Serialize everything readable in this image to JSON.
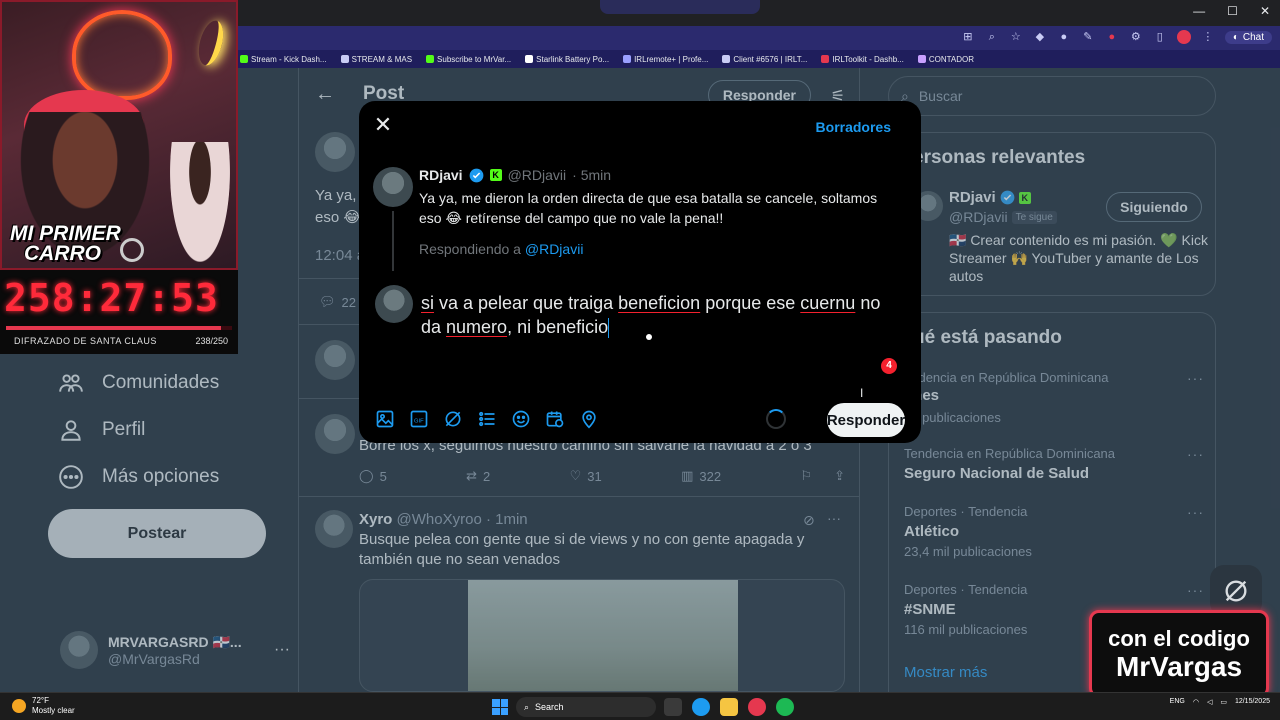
{
  "browser": {
    "controls": [
      "—",
      "☐",
      "✕"
    ],
    "chat_label": "Chat",
    "bookmarks": [
      {
        "label": "Stream - Kick Dash...",
        "color": "#53fc18"
      },
      {
        "label": "STREAM & MAS",
        "color": "#c9ccf5"
      },
      {
        "label": "Subscribe to MrVar...",
        "color": "#53fc18"
      },
      {
        "label": "Starlink Battery Po...",
        "color": "#ffffff"
      },
      {
        "label": "IRLremote+ | Profe...",
        "color": "#9aa0ff"
      },
      {
        "label": "Client #6576 | IRLT...",
        "color": "#c9ccf5"
      },
      {
        "label": "IRLToolkit - Dashb...",
        "color": "#e5384f"
      },
      {
        "label": "CONTADOR",
        "color": "#c9a0ff"
      }
    ]
  },
  "nav": {
    "items": [
      {
        "label": "Comunidades",
        "icon": "communities-icon"
      },
      {
        "label": "Perfil",
        "icon": "profile-icon"
      },
      {
        "label": "Más opciones",
        "icon": "more-options-icon"
      }
    ],
    "post_button": "Postear",
    "account": {
      "name": "MRVARGASRD 🇩🇴...",
      "handle": "@MrVargasRd"
    }
  },
  "center": {
    "title": "Post",
    "reply_pill": "Responder",
    "main_post_partial": "Ya ya,",
    "main_post_partial2": "eso 😂",
    "time_partial": "12:04 a",
    "reply_count_partial": "22",
    "second_post_text": "Borre los x, seguimos nuestro camino sin salvarle la navidad a 2 o 3",
    "second_post_stats": {
      "replies": "5",
      "reposts": "2",
      "likes": "31",
      "views": "322"
    },
    "third_post": {
      "name": "Xyro",
      "handle": "@WhoXyroo",
      "time": "· 1min",
      "text": "Busque pelea con gente que si de views y no con gente apagada y también que no sean venados"
    }
  },
  "right": {
    "search_placeholder": "Buscar",
    "relevant_title": "ersonas relevantes",
    "relevant_user": {
      "name": "RDjavi",
      "handle": "@RDjavii",
      "follows_you": "Te sigue",
      "follow_button": "Siguiendo",
      "bio": "🇩🇴 Crear contenido es mi pasión. 💚 Kick Streamer 🙌 YouTuber y amante de Los autos"
    },
    "trending_title": "ué está pasando",
    "trends": [
      {
        "meta": "endencia en República Dominicana",
        "name": "ones",
        "count": "71 publicaciones"
      },
      {
        "meta": "Tendencia en República Dominicana",
        "name": "Seguro Nacional de Salud",
        "count": ""
      },
      {
        "meta": "Deportes · Tendencia",
        "name": "Atlético",
        "count": "23,4 mil publicaciones"
      },
      {
        "meta": "Deportes · Tendencia",
        "name": "#SNME",
        "count": "116 mil publicaciones"
      }
    ],
    "show_more": "Mostrar más"
  },
  "modal": {
    "drafts": "Borradores",
    "original": {
      "name": "RDjavi",
      "handle": "@RDjavii",
      "time": "· 5min",
      "text": "Ya ya, me dieron la orden directa de que esa batalla se cancele, soltamos eso 😂 retírense del campo que no vale la pena!!"
    },
    "replying_prefix": "Respondiendo a",
    "replying_to": "@RDjavii",
    "compose_parts": [
      {
        "t": "si",
        "sp": true
      },
      {
        "t": " va a pelear que traiga ",
        "sp": false
      },
      {
        "t": "beneficion",
        "sp": true
      },
      {
        "t": " porque ese ",
        "sp": false
      },
      {
        "t": "cuernu",
        "sp": true
      },
      {
        "t": " no da ",
        "sp": false
      },
      {
        "t": "numero",
        "sp": true
      },
      {
        "t": ", ni beneficio",
        "sp": false
      }
    ],
    "char_counter": "4",
    "reply_button": "Responder",
    "tool_icons": [
      "image-icon",
      "gif-icon",
      "grok-icon",
      "poll-icon",
      "emoji-icon",
      "schedule-icon",
      "location-icon"
    ]
  },
  "stream": {
    "title_line1": "MI PRIMER",
    "title_line2": "CARRO",
    "timer": "258:27:53",
    "goal_label": "DIFRAZADO DE SANTA CLAUS",
    "goal_count": "238/250",
    "goal_progress": 0.952,
    "promo_line1": "con el codigo",
    "promo_line2": "MrVargas"
  },
  "taskbar": {
    "temp": "72°F",
    "weather": "Mostly clear",
    "search": "Search",
    "lang": "ENG",
    "date": "12/15/2025"
  },
  "colors": {
    "accent": "#1d9bf0",
    "bg": "#15202b",
    "stream_red": "#e5384f"
  }
}
